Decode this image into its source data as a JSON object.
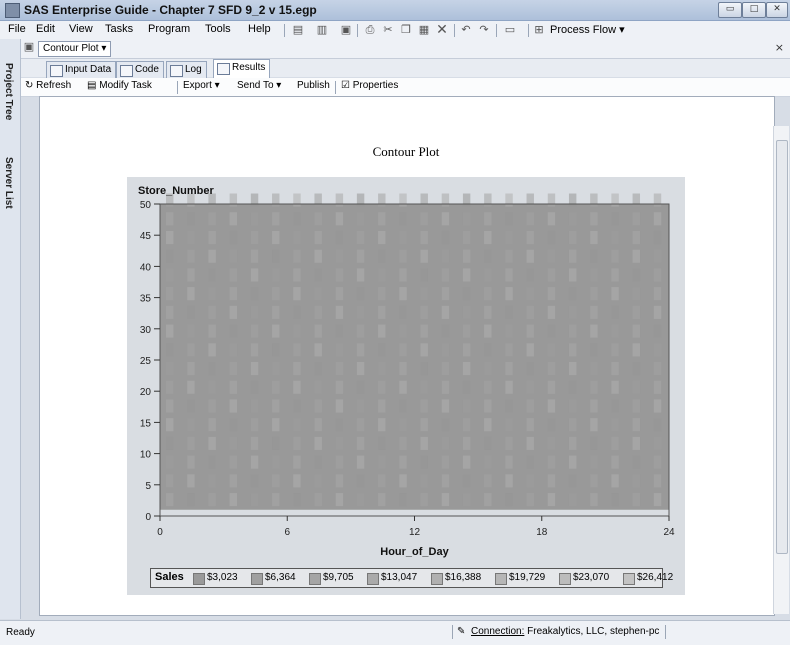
{
  "window": {
    "title": "SAS Enterprise Guide - Chapter 7 SFD 9_2 v 15.egp"
  },
  "menu": [
    "File",
    "Edit",
    "View",
    "Tasks",
    "Program",
    "Tools",
    "Help"
  ],
  "toolbar": {
    "process_flow": "Process Flow"
  },
  "side_tabs": {
    "project_tree": "Project Tree",
    "server_list": "Server List"
  },
  "doc": {
    "selector": "Contour Plot ▾",
    "close": "×"
  },
  "tabs": [
    {
      "label": "Input Data"
    },
    {
      "label": "Code"
    },
    {
      "label": "Log"
    },
    {
      "label": "Results"
    }
  ],
  "results_toolbar": {
    "refresh": "Refresh",
    "modify": "Modify Task",
    "export": "Export ▾",
    "send_to": "Send To ▾",
    "publish": "Publish",
    "properties": "Properties"
  },
  "status": {
    "ready": "Ready",
    "connection_label": "Connection:",
    "connection_value": "Freakalytics, LLC, stephen-pc"
  },
  "colors": {
    "plot_bg": "#d9dde2",
    "fill_dark": "#999999",
    "fill_light": "#b8b8b8"
  },
  "chart_data": {
    "type": "heatmap",
    "title": "Contour Plot",
    "xlabel": "Hour_of_Day",
    "ylabel": "Store_Number",
    "xlim": [
      0,
      24
    ],
    "ylim": [
      0,
      50
    ],
    "xticks": [
      "0",
      "6",
      "12",
      "18",
      "24"
    ],
    "yticks": [
      "0",
      "5",
      "10",
      "15",
      "20",
      "25",
      "30",
      "35",
      "40",
      "45",
      "50"
    ],
    "legend_title": "Sales",
    "legend": [
      "$3,023",
      "$6,364",
      "$9,705",
      "$13,047",
      "$16,388",
      "$19,729",
      "$23,070",
      "$26,412"
    ],
    "grid": false
  }
}
